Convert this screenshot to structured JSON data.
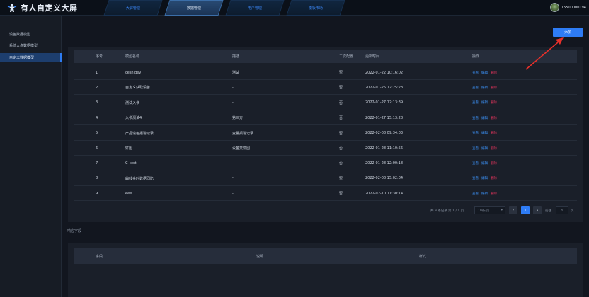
{
  "header": {
    "title": "有人自定义大屏",
    "tabs": [
      "大屏管理",
      "数据管理",
      "用户管理",
      "模板市场"
    ],
    "active_tab": 1,
    "user_phone": "15500000194"
  },
  "sidebar": {
    "items": [
      {
        "label": "设备数据模型"
      },
      {
        "label": "系统大盘数据模型"
      },
      {
        "label": "自定义数据模型"
      }
    ],
    "active": 2
  },
  "toolbar": {
    "add_label": "添加"
  },
  "table": {
    "columns": [
      "序号",
      "模型名称",
      "描述",
      "二次配置",
      "更新时间",
      "操作"
    ],
    "rows": [
      {
        "no": "1",
        "name": "ceshidev",
        "desc": "测试",
        "config": "否",
        "time": "2022-01-22 10:16:02"
      },
      {
        "no": "2",
        "name": "自定义获取设备",
        "desc": "-",
        "config": "否",
        "time": "2022-01-25 12:25:28"
      },
      {
        "no": "3",
        "name": "测试入参",
        "desc": "-",
        "config": "否",
        "time": "2022-01-27 12:13:39"
      },
      {
        "no": "4",
        "name": "入参测试4",
        "desc": "第三方",
        "config": "否",
        "time": "2022-01-27 15:13:28"
      },
      {
        "no": "5",
        "name": "产品设备报警记录",
        "desc": "变量报警记录",
        "config": "否",
        "time": "2022-02-08 09:34:03"
      },
      {
        "no": "6",
        "name": "饼图",
        "desc": "设备类饼图",
        "config": "否",
        "time": "2022-01-28 11:10:56"
      },
      {
        "no": "7",
        "name": "C_test",
        "desc": "-",
        "config": "否",
        "time": "2022-01-28 12:00:18"
      },
      {
        "no": "8",
        "name": "曲线实时数据同比",
        "desc": "-",
        "config": "否",
        "time": "2022-02-08 15:02:04"
      },
      {
        "no": "9",
        "name": "eee",
        "desc": "-",
        "config": "否",
        "time": "2022-02-10 11:30:14"
      }
    ],
    "actions": {
      "view": "查看",
      "edit": "编辑",
      "delete": "删除"
    }
  },
  "pagination": {
    "summary": "共 9 条记录 第 1 / 1 页",
    "page_size": "10条/页",
    "prev": "‹",
    "current_page": "1",
    "next": "›",
    "goto_label": "前往",
    "goto_value": "1",
    "goto_suffix": "页"
  },
  "fields_section": {
    "title": "响应字段",
    "columns": [
      "字段",
      "说明",
      "样式"
    ]
  },
  "colors": {
    "accent": "#2e7cf5",
    "danger": "#e0345c",
    "bg": "#12161f",
    "panel": "#1a1f29",
    "arrow": "#e8302a"
  }
}
